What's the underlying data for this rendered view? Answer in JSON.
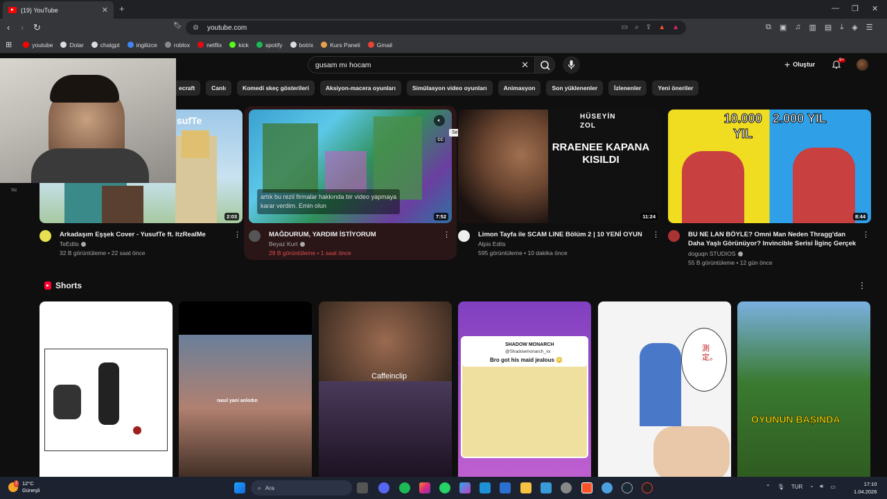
{
  "browser": {
    "tab_title": "(19) YouTube",
    "address": "youtube.com",
    "bookmarks": [
      {
        "label": "youtube",
        "color": "#ff0000"
      },
      {
        "label": "Dolar",
        "color": "#dddddd"
      },
      {
        "label": "chatgpt",
        "color": "#dddddd"
      },
      {
        "label": "ingilizce",
        "color": "#4285f4"
      },
      {
        "label": "roblox",
        "color": "#888888"
      },
      {
        "label": "netflix",
        "color": "#e50914"
      },
      {
        "label": "kick",
        "color": "#53fc18"
      },
      {
        "label": "spotify",
        "color": "#1db954"
      },
      {
        "label": "botrix",
        "color": "#dddddd"
      },
      {
        "label": "Kurs Paneli",
        "color": "#e8a04b"
      },
      {
        "label": "Gmail",
        "color": "#ea4335"
      }
    ]
  },
  "youtube": {
    "search_value": "gusam mı hocam",
    "create_label": "Oluştur",
    "notif_count": "9+",
    "sidebar_you": "Siz",
    "chips": [
      "ecraft",
      "Canlı",
      "Komedi skeç gösterileri",
      "Aksiyon-macera oyunları",
      "Simülasyon video oyunları",
      "Animasyon",
      "Son yüklenenler",
      "İzlenenler",
      "Yeni öneriler"
    ],
    "tooltip": "Sesi kapat",
    "videos": [
      {
        "title": "Arkadaşım Eşşek Cover - YusufTe ft. ItzRealMe",
        "channel": "TeEdits",
        "meta": "32 B görüntüleme • 22 saat önce",
        "duration": "2:03",
        "thumb_text": "sufTe"
      },
      {
        "title": "MAĞDURUM, YARDIM İSTİYORUM",
        "channel": "Beyaz Kurt",
        "meta": "29 B görüntüleme • 1 saat önce",
        "duration": "7:52",
        "caption": "artık bu rezil firmalar hakkında bir video yapmaya karar verdim. Emin olun"
      },
      {
        "title": "Limon Tayfa ile SCAM LINE Bölüm 2 | 10 YENİ OYUN",
        "channel": "Alpis Edits",
        "meta": "595 görüntüleme • 10 dakika önce",
        "duration": "11:24",
        "thumb_top": "HÜSEYİN ZOL",
        "thumb_text": "RRAENEE KAPANA KISILDI"
      },
      {
        "title": "BU NE LAN BÖYLE? Omni Man Neden Thragg'dan Daha Yaşlı Görünüyor? Invincible Serisi İlginç Gerçek",
        "channel": "doguqn STUDIOS",
        "meta": "55 B görüntüleme • 12 gün önce",
        "duration": "8:44",
        "left_text": "10.000 YIL",
        "right_text": "2.000 YIL"
      }
    ],
    "shorts_title": "Shorts",
    "shorts": [
      {
        "caption": ""
      },
      {
        "caption": "nasıl yani anlodın"
      },
      {
        "caption": "Caffeinclip"
      },
      {
        "caption": "Bro got his maid jealous 😳",
        "header": "SHADOW MONARCH",
        "handle": "@Shadowmonarch_xx"
      },
      {
        "caption": "測定。"
      },
      {
        "caption": "OYUNUN BAŞINDA"
      }
    ]
  },
  "taskbar": {
    "temp": "12°C",
    "weather": "Güneşli",
    "weather_badge": "2",
    "search_placeholder": "Ara",
    "lang": "TUR",
    "time": "17:10",
    "date": "1.04.2026"
  }
}
